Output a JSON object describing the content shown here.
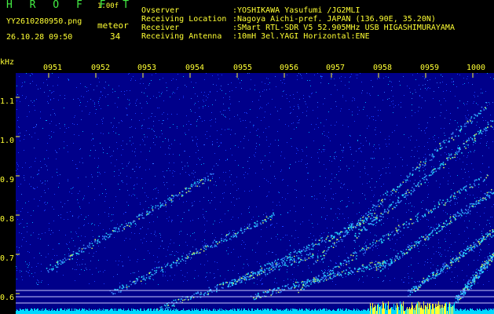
{
  "app": {
    "title": "H R O F F T",
    "version": "1.00f"
  },
  "file": {
    "name": "YY2610280950.png",
    "datetime": "26.10.28 09:50"
  },
  "meteor": {
    "label": "meteor",
    "count": "34"
  },
  "meta": [
    {
      "key": "Ovserver",
      "value": ":YOSHIKAWA Yasufumi /JG2MLI"
    },
    {
      "key": "Receiving Location",
      "value": ":Nagoya Aichi-pref. JAPAN (136.90E, 35.20N)"
    },
    {
      "key": "Receiver",
      "value": ":SMart RTL-SDR V5 52.905MHz USB HIGASHIMURAYAMA"
    },
    {
      "key": "Receiving Antenna",
      "value": ":10mH 3el.YAGI Horizontal:ENE"
    }
  ],
  "axis": {
    "unit": "kHz",
    "y_ticks": [
      "1.1",
      "1.0",
      "0.9",
      "0.8",
      "0.7",
      "0.6"
    ],
    "y_values": [
      1.1,
      1.0,
      0.9,
      0.8,
      0.7,
      0.6
    ],
    "x_ticks": [
      "0951",
      "0952",
      "0953",
      "0954",
      "0955",
      "0956",
      "0957",
      "0958",
      "0959",
      "1000"
    ]
  },
  "colors": {
    "background": "#000000",
    "plot": "#00008a",
    "label": "#ffff33",
    "title": "#44ee44",
    "noise": "#00d8ff",
    "signal": "#66ffcc"
  }
}
